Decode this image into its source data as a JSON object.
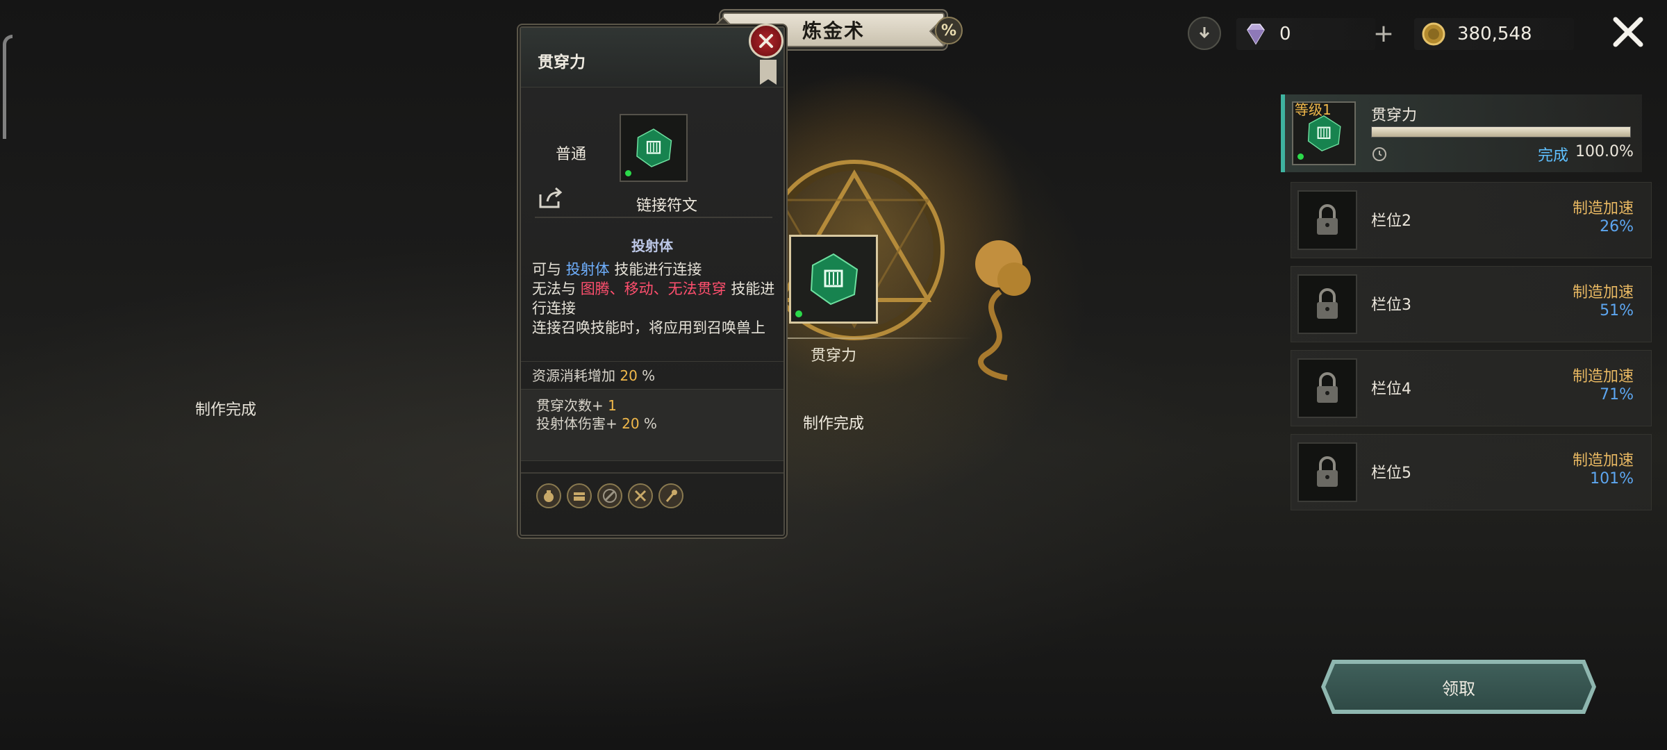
{
  "header": {
    "title": "炼金术",
    "percent_symbol": "%",
    "gems": "0",
    "gold": "380,548",
    "plus": "+"
  },
  "tooltip": {
    "title": "贯穿力",
    "grade": "普通",
    "item_name": "链接符文",
    "subheading": "投射体",
    "desc_line1_prefix": "可与 ",
    "desc_line1_highlight": "投射体",
    "desc_line1_suffix": " 技能进行连接",
    "desc_line2_prefix": "无法与 ",
    "desc_line2_highlight": "图腾、移动、无法贯穿",
    "desc_line2_suffix": " 技能进行连接",
    "desc_line3": "连接召唤技能时，将应用到召唤兽上",
    "cost_label": "资源消耗增加 ",
    "cost_value": "20",
    "cost_unit": " %",
    "bonus1_label": "贯穿次数+ ",
    "bonus1_value": "1",
    "bonus2_label": "投射体伤害+ ",
    "bonus2_value": "20",
    "bonus2_unit": " %"
  },
  "center": {
    "slot_label": "贯穿力",
    "status": "制作完成"
  },
  "left_status": "制作完成",
  "queue": {
    "active": {
      "level": "等级1",
      "name": "贯穿力",
      "progress": 1.0,
      "done_label": "完成",
      "percent": "100.0%"
    },
    "rows": [
      {
        "name": "栏位2",
        "boost_label": "制造加速",
        "boost_value": "26%"
      },
      {
        "name": "栏位3",
        "boost_label": "制造加速",
        "boost_value": "51%"
      },
      {
        "name": "栏位4",
        "boost_label": "制造加速",
        "boost_value": "71%"
      },
      {
        "name": "栏位5",
        "boost_label": "制造加速",
        "boost_value": "101%"
      }
    ]
  },
  "claim_button": "领取",
  "colors": {
    "accent_gold": "#f0b84a",
    "link_blue": "#6fb0ff",
    "warn_red": "#ff4f6e",
    "teal": "#3fb3a0"
  },
  "icons": {
    "gem": "gem-icon",
    "gold": "gold-coin-icon",
    "download": "download-icon",
    "close": "close-icon",
    "lock": "lock-icon",
    "rune": "green-rune-icon",
    "share": "share-icon",
    "clock": "clock-icon",
    "weapon_icons": [
      "bag-icon",
      "chest-icon",
      "disabled-sword-icon",
      "crossed-tools-icon",
      "staff-icon"
    ]
  }
}
